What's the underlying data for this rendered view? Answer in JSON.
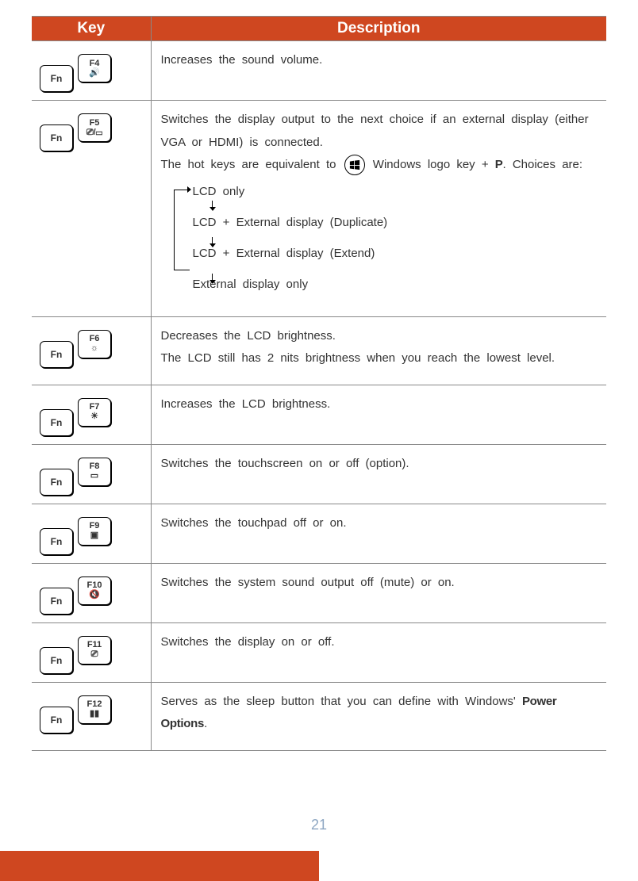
{
  "headers": {
    "key": "Key",
    "desc": "Description"
  },
  "fn_label": "Fn",
  "rows": [
    {
      "f": "F4",
      "icon": "🔊",
      "desc": "Increases the sound volume."
    },
    {
      "f": "F5",
      "icon": "⎚/▭",
      "desc_p1": "Switches the display output to the next choice if an external display (either VGA or HDMI) is connected.",
      "desc_p2a": "The hot keys are equivalent to ",
      "desc_p2b": " Windows logo key + ",
      "desc_p2_p": "P",
      "desc_p2_end": ". Choices are:",
      "flow": {
        "a": "LCD only",
        "b": "LCD + External display (Duplicate)",
        "c": "LCD + External display (Extend)",
        "d": "External display only"
      }
    },
    {
      "f": "F6",
      "icon": "☼",
      "desc_p1": "Decreases the LCD brightness.",
      "desc_p2a": "The LCD still has ",
      "desc_p2_num": "2",
      "desc_p2b": " nits brightness when you reach the lowest level."
    },
    {
      "f": "F7",
      "icon": "☀",
      "desc": "Increases the LCD brightness."
    },
    {
      "f": "F8",
      "icon": "▭",
      "desc": "Switches the touchscreen on or off (option)."
    },
    {
      "f": "F9",
      "icon": "▣",
      "desc": "Switches the touchpad off or on."
    },
    {
      "f": "F10",
      "icon": "🔇",
      "desc": "Switches the system sound output off (mute) or on."
    },
    {
      "f": "F11",
      "icon": "⎚",
      "desc": "Switches the display on or off."
    },
    {
      "f": "F12",
      "icon": "▮▮",
      "desc_a": "Serves as the sleep button that you can define with Windows' ",
      "desc_bold": "Power Options",
      "desc_b": "."
    }
  ],
  "page_number": "21"
}
